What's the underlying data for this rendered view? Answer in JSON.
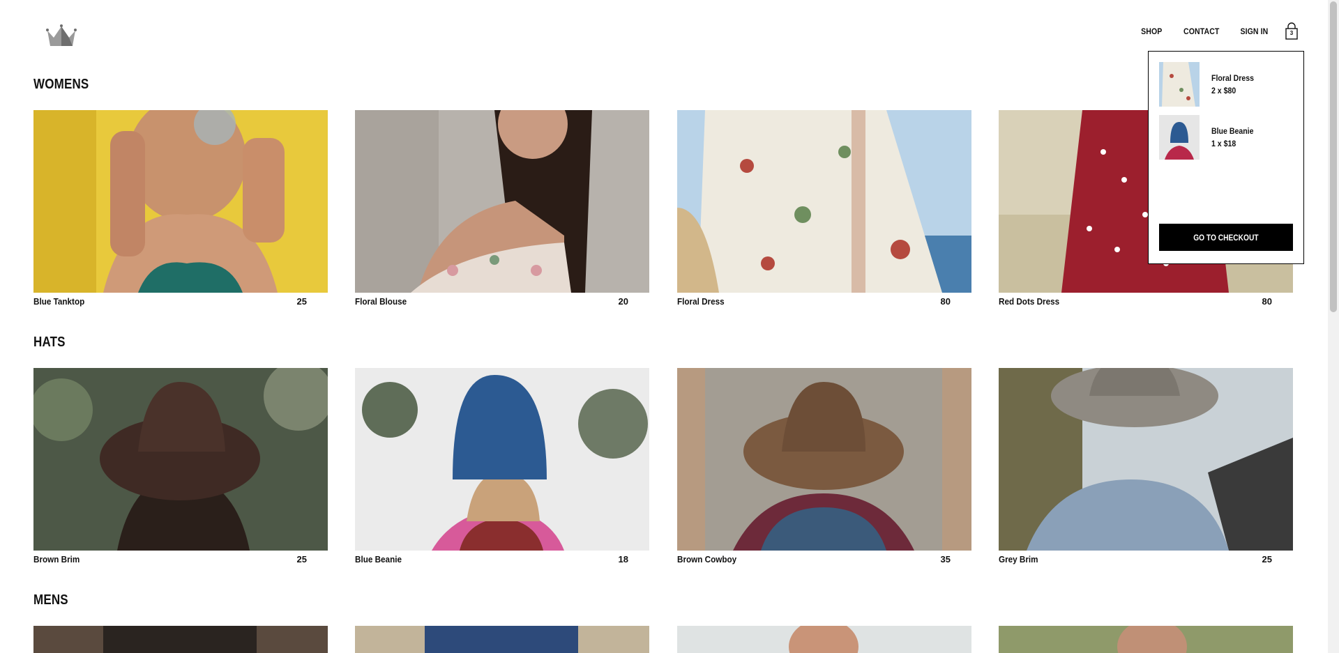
{
  "nav": {
    "shop": "SHOP",
    "contact": "CONTACT",
    "sign_in": "SIGN IN",
    "cart_count": "3"
  },
  "sections": [
    {
      "title": "WOMENS",
      "items": [
        {
          "name": "Blue Tanktop",
          "price": "25"
        },
        {
          "name": "Floral Blouse",
          "price": "20"
        },
        {
          "name": "Floral Dress",
          "price": "80"
        },
        {
          "name": "Red Dots Dress",
          "price": "80"
        }
      ]
    },
    {
      "title": "HATS",
      "items": [
        {
          "name": "Brown Brim",
          "price": "25"
        },
        {
          "name": "Blue Beanie",
          "price": "18"
        },
        {
          "name": "Brown Cowboy",
          "price": "35"
        },
        {
          "name": "Grey Brim",
          "price": "25"
        }
      ]
    },
    {
      "title": "MENS",
      "items": []
    }
  ],
  "cart": {
    "items": [
      {
        "name": "Floral Dress",
        "qty": "2 x $80"
      },
      {
        "name": "Blue Beanie",
        "qty": "1 x $18"
      }
    ],
    "checkout_label": "GO TO CHECKOUT"
  },
  "icons": {
    "logo": "crown-icon",
    "cart": "shopping-bag-icon"
  },
  "colors": {
    "accent": "#000000",
    "background": "#ffffff"
  }
}
